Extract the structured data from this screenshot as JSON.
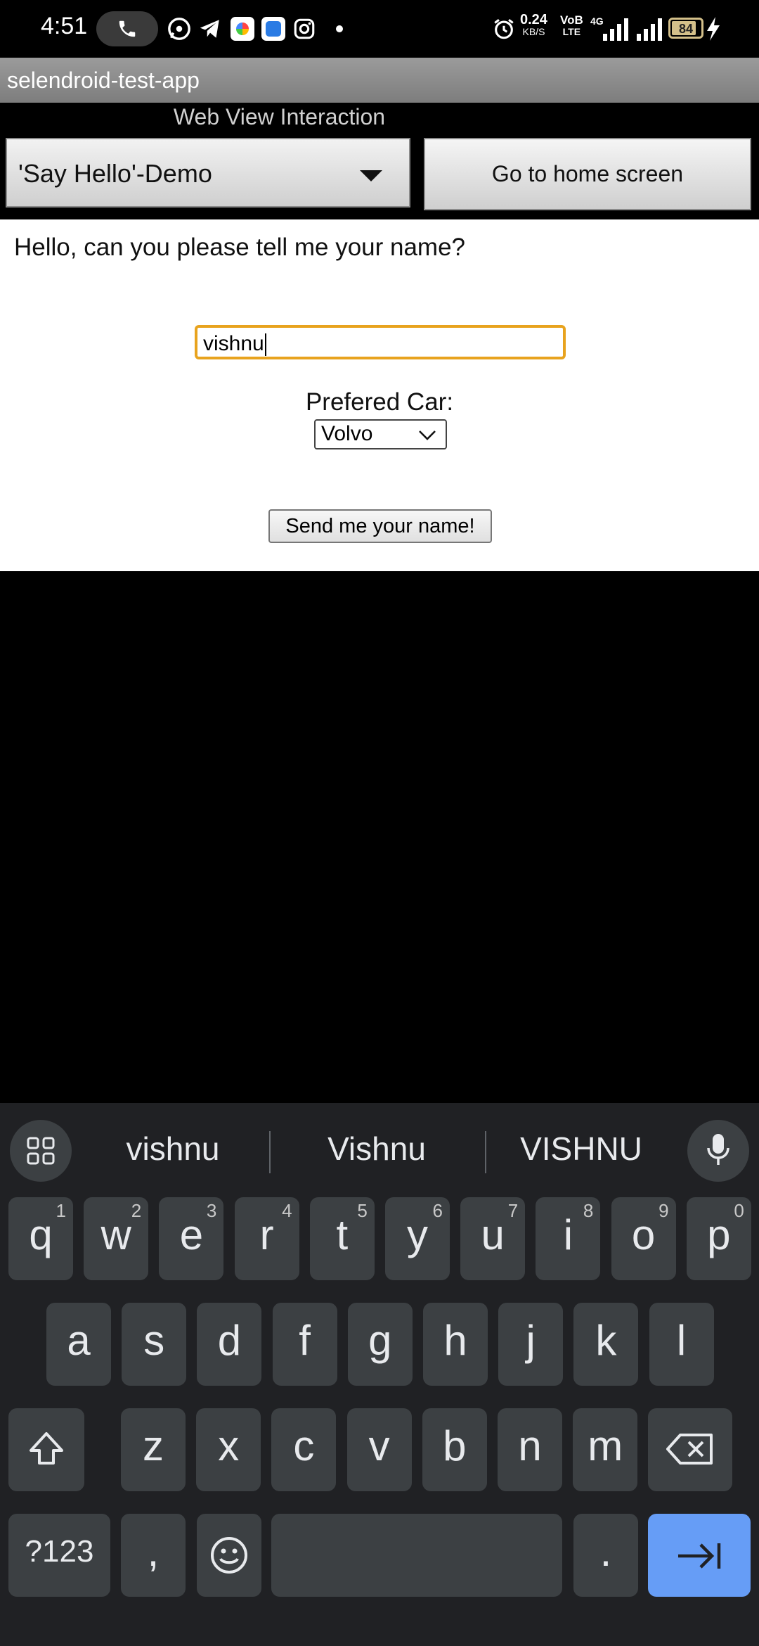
{
  "status_bar": {
    "time": "4:51",
    "net_speed_value": "0.24",
    "net_speed_unit": "KB/S",
    "volte_top": "VoB",
    "volte_bottom": "LTE",
    "network_type": "4G",
    "battery_level": "84",
    "battery_fraction": 0.84,
    "icons": [
      "phone-call-icon",
      "whatsapp-icon",
      "telegram-icon",
      "gallery-icon",
      "app-icon",
      "instagram-icon",
      "alarm-icon",
      "signal-icon",
      "charging-icon"
    ]
  },
  "app_bar": {
    "title": "selendroid-test-app"
  },
  "activity": {
    "title": "Web View Interaction",
    "spinner_value": "'Say Hello'-Demo",
    "home_button": "Go to home screen"
  },
  "webview": {
    "question": "Hello, can you please tell me your name?",
    "name_value": "vishnu",
    "car_label": "Prefered Car:",
    "car_selected": "Volvo",
    "send_button": "Send me your name!"
  },
  "keyboard": {
    "suggestions": [
      "vishnu",
      "Vishnu",
      "VISHNU"
    ],
    "row1": [
      {
        "k": "q",
        "h": "1"
      },
      {
        "k": "w",
        "h": "2"
      },
      {
        "k": "e",
        "h": "3"
      },
      {
        "k": "r",
        "h": "4"
      },
      {
        "k": "t",
        "h": "5"
      },
      {
        "k": "y",
        "h": "6"
      },
      {
        "k": "u",
        "h": "7"
      },
      {
        "k": "i",
        "h": "8"
      },
      {
        "k": "o",
        "h": "9"
      },
      {
        "k": "p",
        "h": "0"
      }
    ],
    "row2": [
      "a",
      "s",
      "d",
      "f",
      "g",
      "h",
      "j",
      "k",
      "l"
    ],
    "row3": [
      "z",
      "x",
      "c",
      "v",
      "b",
      "n",
      "m"
    ],
    "symbols_key": "?123",
    "comma_key": ",",
    "period_key": ".",
    "enter_color": "#669df6",
    "background_color": "#202124",
    "key_color": "#3c4043"
  },
  "colors": {
    "input_focus_border": "#e8a31e",
    "app_bar": "#8a8a8a"
  }
}
